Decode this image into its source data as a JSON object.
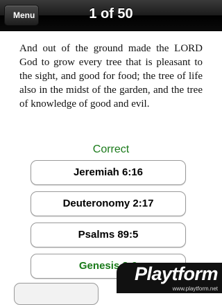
{
  "navbar": {
    "back_label": "Menu",
    "title": "1 of 50"
  },
  "quiz": {
    "verse": "And out of the ground made the LORD God to grow every tree that is pleasant to the sight, and good for food; the tree of life also in the midst of the garden, and the tree of knowledge of good and evil.",
    "status": "Correct",
    "answers": [
      {
        "label": "Jeremiah 6:16",
        "correct": false
      },
      {
        "label": "Deuteronomy 2:17",
        "correct": false
      },
      {
        "label": "Psalms 89:5",
        "correct": false
      },
      {
        "label": "Genesis 2:9",
        "correct": true
      }
    ]
  },
  "watermark": {
    "logo": "Playtform",
    "url": "www.playtform.net"
  },
  "colors": {
    "correct_green": "#1a7a1a",
    "navbar_black": "#000000"
  }
}
